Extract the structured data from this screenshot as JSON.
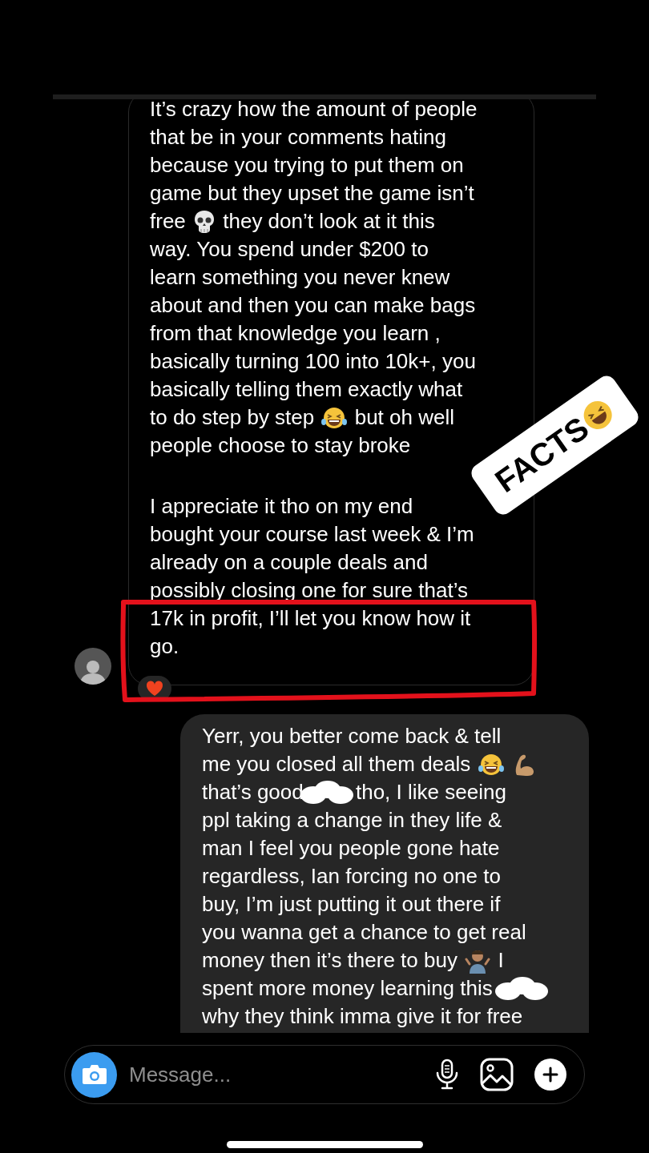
{
  "received": {
    "highlighted": true,
    "reacted": true,
    "paragraphs": [
      [
        "It’s crazy how the amount of people",
        "that be in your comments hating",
        "because you trying to put them on",
        "game but they upset the game isn’t",
        [
          "free ",
          {
            "kind": "skull"
          },
          " they don’t look at it this"
        ],
        "way. You spend under $200 to",
        "learn something you never knew",
        "about and then you can make bags",
        "from that knowledge you learn ,",
        "basically turning 100 into 10k+, you",
        "basically telling them exactly what",
        [
          "to do step by step ",
          {
            "kind": "laugh"
          },
          " but oh well"
        ],
        "people choose to stay broke"
      ],
      [
        "I appreciate it tho on my end",
        "bought your course last week & I’m",
        "already on a couple deals and",
        "possibly closing one for sure that’s",
        "17k in profit, I’ll let you know how it",
        "go."
      ]
    ]
  },
  "sent": {
    "lines": [
      "Yerr, you better come back & tell",
      [
        "me you closed all them deals ",
        {
          "kind": "laugh"
        },
        {
          "kind": "muscle"
        }
      ],
      [
        "that’s good",
        {
          "kind": "censor"
        },
        " tho, I like seeing"
      ],
      "ppl taking a change in they life &",
      "man I feel you people gone hate",
      "regardless, Ian forcing no one to",
      "buy, I’m just putting it out there if",
      "you wanna get a chance to get real",
      [
        "money then it’s there to buy ",
        {
          "kind": "shrug"
        },
        " I"
      ],
      [
        "spent more money learning this ",
        {
          "kind": "censor"
        }
      ],
      "why they think imma give it for free"
    ]
  },
  "sticker": {
    "text": "FACTS"
  },
  "composer": {
    "placeholder": "Message..."
  }
}
